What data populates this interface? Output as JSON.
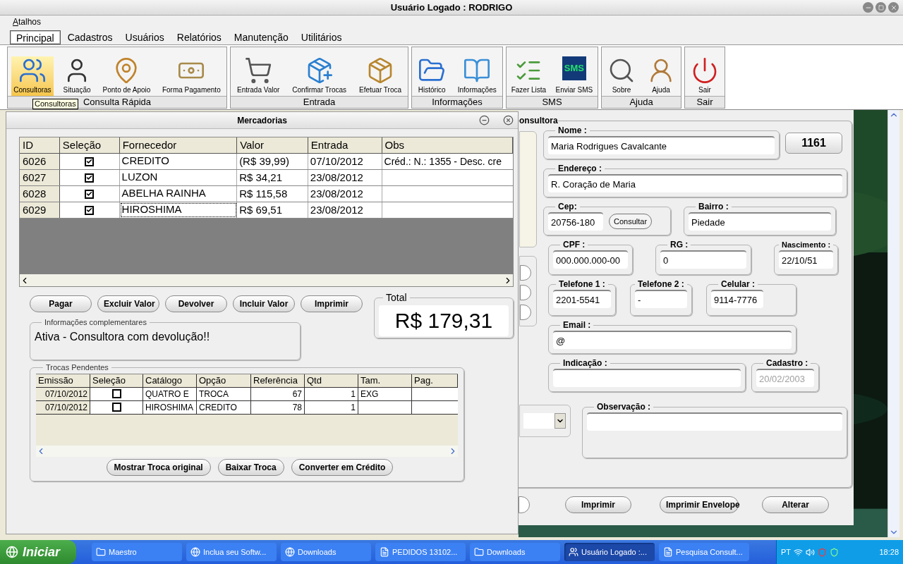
{
  "window": {
    "title": "Usuário Logado : RODRIGO"
  },
  "menu": [
    "Atalhos"
  ],
  "tabs": [
    {
      "label": "Principal",
      "selected": true
    },
    {
      "label": "Cadastros",
      "selected": false
    },
    {
      "label": "Usuários",
      "selected": false
    },
    {
      "label": "Relatórios",
      "selected": false
    },
    {
      "label": "Manutenção",
      "selected": false
    },
    {
      "label": "Utilitários",
      "selected": false
    }
  ],
  "ribbon": {
    "groups": [
      {
        "label": "Consulta Rápida",
        "items": [
          {
            "label": "Consultoras",
            "selected": true
          },
          {
            "label": "Situação",
            "selected": false
          },
          {
            "label": "Ponto de Apoio",
            "selected": false
          },
          {
            "label": "Forma Pagamento",
            "selected": false
          }
        ]
      },
      {
        "label": "Entrada",
        "items": [
          {
            "label": "Entrada Valor",
            "selected": false
          },
          {
            "label": "Confirmar Trocas",
            "selected": false
          },
          {
            "label": "Efetuar Troca",
            "selected": false
          }
        ]
      },
      {
        "label": "Informações",
        "items": [
          {
            "label": "Histórico",
            "selected": false
          },
          {
            "label": "Informações",
            "selected": false
          }
        ]
      },
      {
        "label": "SMS",
        "items": [
          {
            "label": "Fazer Lista",
            "selected": false
          },
          {
            "label": "Enviar SMS",
            "selected": false,
            "icon_text": "SMS"
          }
        ]
      },
      {
        "label": "Ajuda",
        "items": [
          {
            "label": "Sobre",
            "selected": false
          },
          {
            "label": "Ajuda",
            "selected": false
          }
        ]
      },
      {
        "label": "Sair",
        "items": [
          {
            "label": "Sair",
            "selected": false
          }
        ]
      }
    ],
    "tooltip": "Consultoras"
  },
  "mercadorias": {
    "title": "Mercadorias",
    "table": {
      "columns": [
        "ID",
        "Seleção",
        "Fornecedor",
        "Valor",
        "Entrada",
        "Obs"
      ],
      "rows": [
        {
          "id": "6026",
          "checked": true,
          "fornecedor": "CREDITO",
          "valor": "(R$ 39,99)",
          "entrada": "07/10/2012",
          "obs": "Créd.: N.: 1355 - Desc. cre",
          "focused": false
        },
        {
          "id": "6027",
          "checked": true,
          "fornecedor": "LUZON",
          "valor": "R$ 34,21",
          "entrada": "23/08/2012",
          "focused": false
        },
        {
          "id": "6028",
          "checked": true,
          "fornecedor": "ABELHA RAINHA",
          "valor": "R$ 115,58",
          "entrada": "23/08/2012",
          "focused": false
        },
        {
          "id": "6029",
          "checked": true,
          "fornecedor": "HIROSHIMA",
          "valor": "R$ 69,51",
          "entrada": "23/08/2012",
          "focused": true
        }
      ]
    },
    "buttons": [
      "Pagar",
      "Excluir Valor",
      "Devolver",
      "Incluir Valor",
      "Imprimir"
    ],
    "total": {
      "label": "Total",
      "value": "R$ 179,31"
    },
    "info": {
      "label": "Informações complementares",
      "text": "Ativa - Consultora com devolução!!"
    },
    "trocas": {
      "label": "Trocas Pendentes",
      "columns": [
        "Emissão",
        "Seleção",
        "Catálogo",
        "Opção",
        "Referência",
        "Qtd",
        "Tam.",
        "Pag."
      ],
      "rows": [
        {
          "emissao": "07/10/2012",
          "checked": false,
          "catalogo": "QUATRO E",
          "opcao": "TROCA",
          "referencia": "67",
          "qtd": "1",
          "tam": "EXG"
        },
        {
          "emissao": "07/10/2012",
          "checked": false,
          "catalogo": "HIROSHIMA",
          "opcao": "CREDITO",
          "referencia": "78",
          "qtd": "1"
        }
      ],
      "buttons": [
        "Mostrar Troca original",
        "Baixar Troca",
        "Converter em Crédito"
      ]
    }
  },
  "consultora": {
    "title": "onsultora",
    "code": "1161",
    "cep_button": "Consultar",
    "fields": {
      "nome": {
        "label": "Nome :",
        "value": "Maria Rodrigues Cavalcante"
      },
      "endereco": {
        "label": "Endereço :",
        "value": "R. Coração de Maria"
      },
      "cep": {
        "label": "Cep:",
        "value": "20756-180"
      },
      "bairro": {
        "label": "Bairro :",
        "value": "Piedade"
      },
      "cpf": {
        "label": "CPF :",
        "value": "000.000.000-00"
      },
      "rg": {
        "label": "RG :",
        "value": "0"
      },
      "nascimento": {
        "label": "Nascimento :",
        "value": "22/10/51"
      },
      "telefone_1": {
        "label": "Telefone 1 :",
        "value": "2201-5541"
      },
      "telefone_2": {
        "label": "Telefone 2 :",
        "value": "-"
      },
      "celular": {
        "label": "Celular :",
        "value": "9114-7776"
      },
      "email": {
        "label": "Email :",
        "value": "@"
      },
      "indicacao": {
        "label": "Indicação :"
      },
      "cadastro": {
        "label": "Cadastro :",
        "value": "20/02/2003",
        "disabled": true
      },
      "observacao": {
        "label": "Observação :"
      }
    },
    "buttons": [
      "Imprimir",
      "Imprimir Envelope",
      "Alterar"
    ]
  },
  "taskbar": {
    "start": "Iniciar",
    "items": [
      {
        "label": "Maestro",
        "selected": false
      },
      {
        "label": "Inclua seu Softw...",
        "selected": false
      },
      {
        "label": "Downloads",
        "selected": false
      },
      {
        "label": "PEDIDOS 13102...",
        "selected": false
      },
      {
        "label": "Downloads",
        "selected": false
      },
      {
        "label": "Usuário Logado :...",
        "selected": true
      },
      {
        "label": "Pesquisa Consult...",
        "selected": false
      }
    ],
    "language": "PT",
    "time": "18:28"
  }
}
